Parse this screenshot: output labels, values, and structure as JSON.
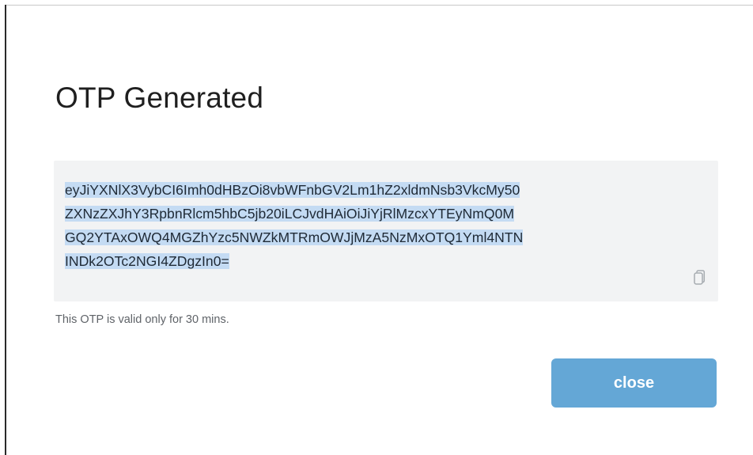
{
  "dialog": {
    "title": "OTP Generated",
    "otp_lines": [
      "eyJiYXNlX3VybCI6Imh0dHBzOi8vbWFnbGV2Lm1hZ2xldmNsb3VkcMy50",
      "ZXNzZXJhY3RpbnRlcm5hbC5jb20iLCJvdHAiOiJiYjRlMzcxYTEyNmQ0M",
      "GQ2YTAxOWQ4MGZhYzc5NWZkMTRmOWJjMzA5NzMxOTQ1Yml4NTN",
      "INDk2OTc2NGI4ZDgzIn0="
    ],
    "copy_icon": "copy-icon",
    "validity_text": "This OTP is valid only for 30 mins.",
    "close_label": "close"
  },
  "colors": {
    "selection": "#c4dbf3",
    "otp_background": "#f2f3f4",
    "button": "#64a7d6"
  }
}
